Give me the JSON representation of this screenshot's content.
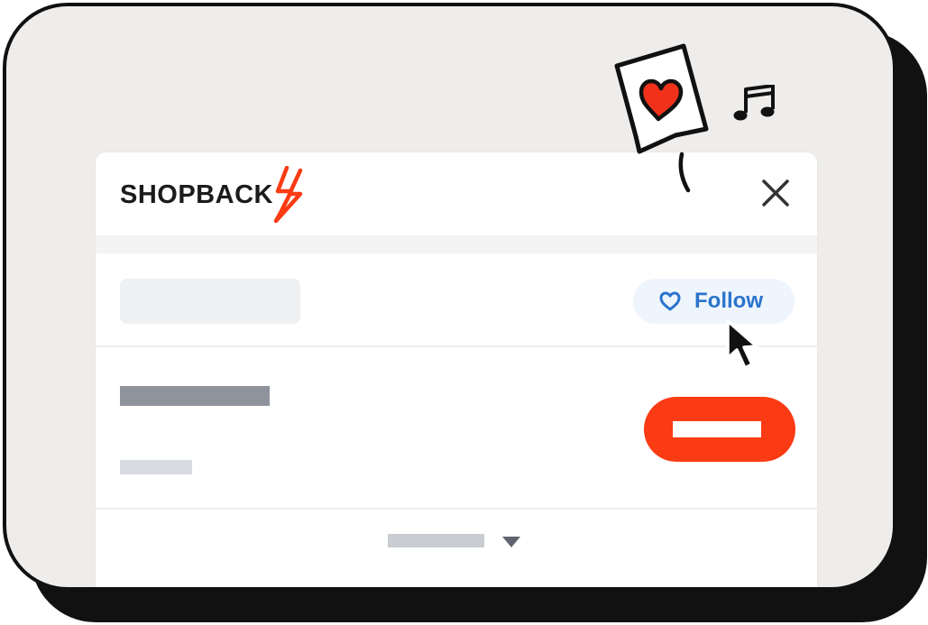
{
  "brand": {
    "logo_text": "SHOPBACK",
    "accent_color": "#FA3B13",
    "text_color": "#1B1B1B"
  },
  "header": {
    "close_icon": "close-icon"
  },
  "merchant_row": {
    "follow_label": "Follow",
    "follow_icon": "heart-outline-icon",
    "follow_color": "#2A74CC"
  },
  "offer_row": {
    "cta_color": "#FA3B13"
  },
  "footer": {
    "dropdown_icon": "chevron-down-icon"
  },
  "decorations": {
    "speech_icon": "heart-speech-bubble-icon",
    "music_icon": "music-note-icon",
    "cursor_icon": "pointer-cursor-icon"
  }
}
